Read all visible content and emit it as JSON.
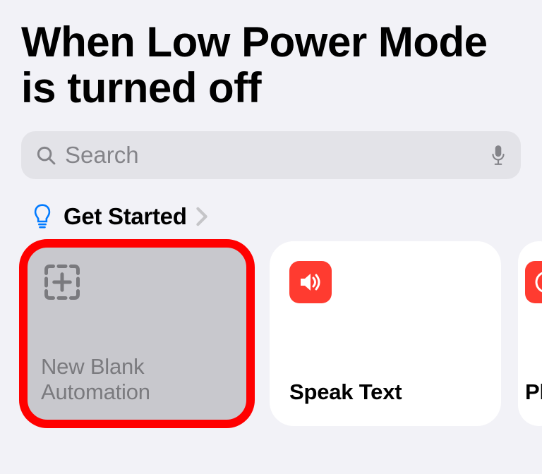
{
  "title": "When Low Power Mode is turned off",
  "search": {
    "placeholder": "Search"
  },
  "section": {
    "label": "Get Started"
  },
  "cards": [
    {
      "label": "New Blank Automation"
    },
    {
      "label": "Speak Text"
    },
    {
      "label": "Play Music"
    }
  ],
  "colors": {
    "accent_red": "#ff3b30",
    "highlight": "#ff0000",
    "tint_blue": "#007aff"
  }
}
